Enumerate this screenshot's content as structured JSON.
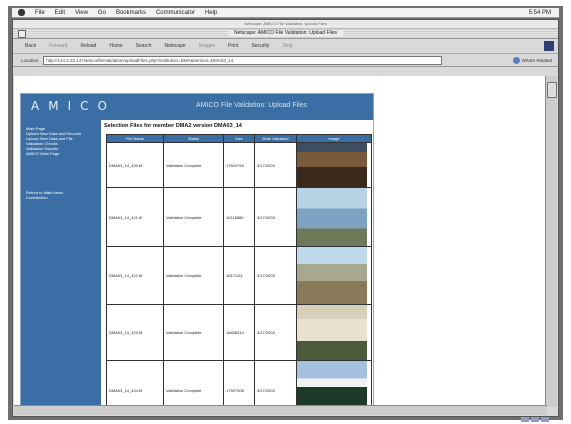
{
  "menubar": {
    "items": [
      "File",
      "Edit",
      "View",
      "Go",
      "Bookmarks",
      "Communicator",
      "Help"
    ],
    "time": "5:54 PM"
  },
  "window": {
    "title_small": "Netscape: AMICO File Validation: Upload Files",
    "title": "Netscape: AMICO File Validation: Upload Files"
  },
  "toolbar": {
    "buttons": [
      "Back",
      "Forward",
      "Reload",
      "Home",
      "Search",
      "Netscape",
      "Images",
      "Print",
      "Security",
      "Stop"
    ]
  },
  "location": {
    "label": "Location:",
    "url": "http://134.2.32.147/amico/fileValidation/uploadFiles.php?institution=DMA&version=DMA03_14",
    "related_label": "What's Related"
  },
  "page": {
    "logo": "AMICO",
    "banner_title": "AMICO File Validation: Upload Files",
    "sidebar_links": [
      "Main Page",
      "Upload New Data and Records",
      "Upload New Data and File",
      "Validation Checks",
      "Validation Reports",
      "AMICO Main Page"
    ],
    "sidebar_links2": [
      "Return to Main Menu",
      "Contribution"
    ],
    "heading": "Selection Files for member DMA2 version DMA03_14"
  },
  "table": {
    "headers": [
      "File Name",
      "Status",
      "Size",
      "Date Validated",
      "Image"
    ],
    "rows": [
      {
        "file": "DMA03_14_420.tif",
        "status": "Validation Complete",
        "size": "17604793",
        "date": "3/17/2003"
      },
      {
        "file": "DMA03_14_421.tif",
        "status": "Validation Complete",
        "size": "16116880",
        "date": "3/17/2003"
      },
      {
        "file": "DMA03_14_422.tif",
        "status": "Validation Complete",
        "size": "18171111",
        "date": "3/17/2003"
      },
      {
        "file": "DMA03_14_423.tif",
        "status": "Validation Complete",
        "size": "16838310",
        "date": "3/17/2003"
      },
      {
        "file": "DMA03_14_424.tif",
        "status": "Validation Complete",
        "size": "17507408",
        "date": "3/17/2003"
      },
      {
        "file": "",
        "status": "",
        "size": "",
        "date": ""
      }
    ]
  }
}
